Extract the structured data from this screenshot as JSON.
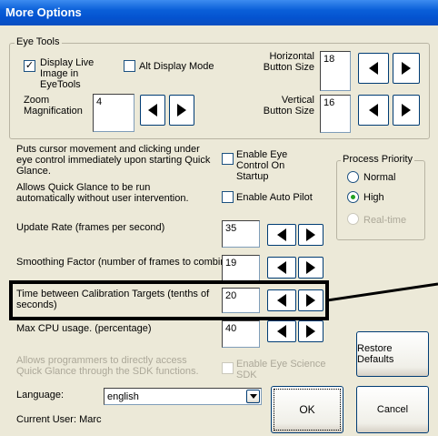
{
  "window": {
    "title": "More Options"
  },
  "eye_tools": {
    "legend": "Eye Tools",
    "display_live_image_label": "Display Live Image in EyeTools",
    "display_live_image_checked": "✓",
    "alt_display_mode_label": "Alt Display Mode",
    "zoom_label": "Zoom Magnification",
    "zoom_value": "4",
    "horizontal_label": "Horizontal Button Size",
    "horizontal_value": "18",
    "vertical_label": "Vertical Button Size",
    "vertical_value": "16"
  },
  "options": {
    "eye_control_desc": "Puts cursor movement and clicking under eye control immediately upon starting Quick Glance.",
    "eye_control_label": "Enable Eye Control On Startup",
    "auto_pilot_desc": "Allows Quick Glance to be run automatically without user intervention.",
    "auto_pilot_label": "Enable Auto Pilot",
    "update_rate_label": "Update Rate (frames per second)",
    "update_rate_value": "35",
    "smoothing_label": "Smoothing Factor (number of frames to combine)",
    "smoothing_value": "19",
    "calibration_label": "Time between Calibration Targets (tenths of seconds)",
    "calibration_value": "20",
    "max_cpu_label": "Max CPU usage. (percentage)",
    "max_cpu_value": "40",
    "sdk_desc": "Allows programmers to directly access Quick Glance through the SDK functions.",
    "sdk_label": "Enable Eye Science SDK"
  },
  "process_priority": {
    "legend": "Process Priority",
    "normal": "Normal",
    "high": "High",
    "realtime": "Real-time"
  },
  "footer": {
    "language_label": "Language:",
    "language_value": "english",
    "current_user": "Current User: Marc",
    "restore_defaults": "Restore Defaults",
    "ok": "OK",
    "cancel": "Cancel"
  },
  "colors": {
    "titlebar": "#0a5fd8",
    "dialog_bg": "#ece9d8",
    "button_border": "#003c74",
    "radio_dot": "#21a121"
  },
  "icons": {
    "decrement": "left-arrow-icon",
    "increment": "right-arrow-icon",
    "dropdown": "chevron-down-icon"
  }
}
